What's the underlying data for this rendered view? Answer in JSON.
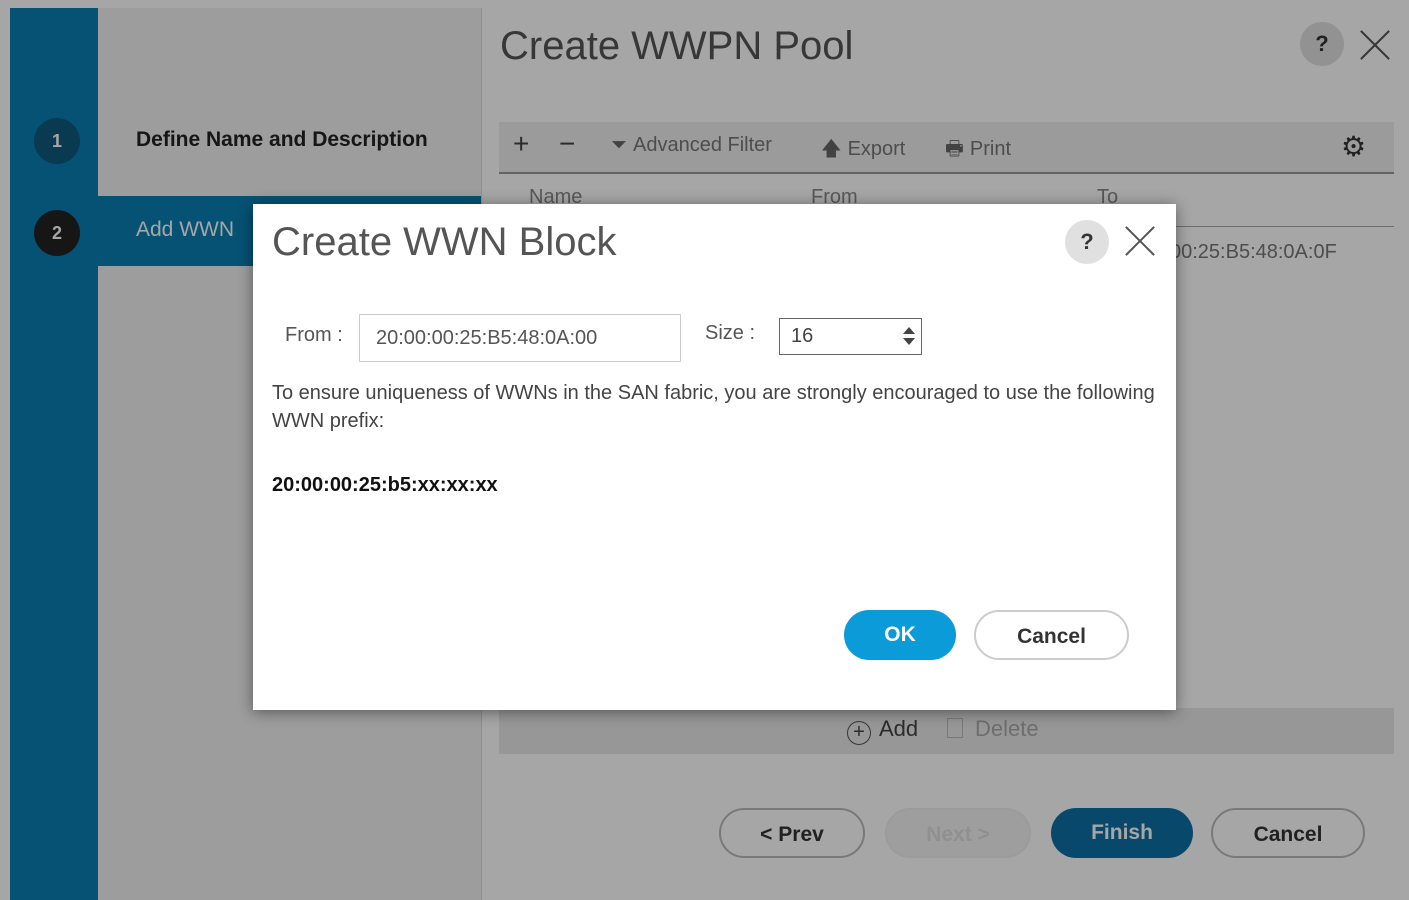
{
  "wizard": {
    "title": "Create WWPN Pool",
    "help_label": "?",
    "steps": [
      {
        "number": "1",
        "label": "Define Name and Description"
      },
      {
        "number": "2",
        "label": "Add WWN"
      }
    ],
    "toolbar": {
      "add": "+",
      "remove": "−",
      "advanced_filter": "Advanced Filter",
      "export": "Export",
      "print": "Print"
    },
    "table": {
      "columns": [
        "Name",
        "From",
        "To"
      ],
      "row_to": "00:25:B5:48:0A:0F"
    },
    "add_label": "Add",
    "delete_label": "Delete",
    "buttons": {
      "prev": "< Prev",
      "next": "Next >",
      "finish": "Finish",
      "cancel": "Cancel"
    }
  },
  "dialog": {
    "title": "Create WWN Block",
    "help_label": "?",
    "from_label": "From :",
    "from_value": "20:00:00:25:B5:48:0A:00",
    "size_label": "Size :",
    "size_value": "16",
    "message": "To ensure uniqueness of WWNs in the SAN fabric, you are strongly encouraged to use the following WWN prefix:",
    "prefix": "20:00:00:25:b5:xx:xx:xx",
    "ok_label": "OK",
    "cancel_label": "Cancel"
  },
  "colors": {
    "accent": "#0a7fb3",
    "primary_button": "#0b9bd8",
    "finish_button": "#0d6fa5"
  }
}
